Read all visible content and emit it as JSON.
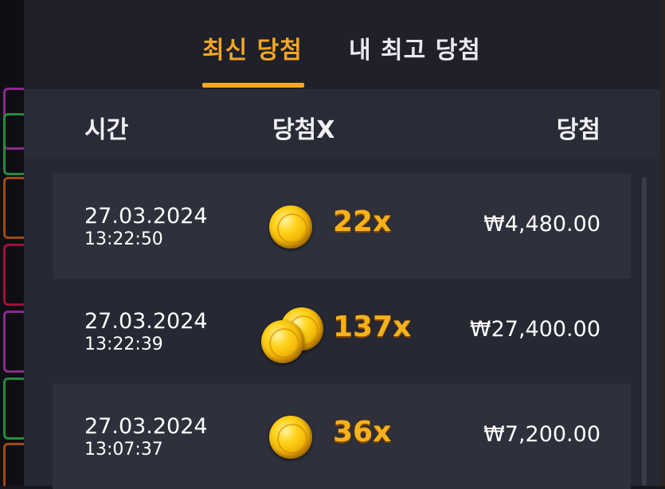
{
  "tabs": [
    {
      "label": "최신 당첨",
      "active": true
    },
    {
      "label": "내 최고 당첨",
      "active": false
    }
  ],
  "columns": {
    "time": "시간",
    "multiplier": "당첨X",
    "win": "당첨"
  },
  "rows": [
    {
      "date": "27.03.2024",
      "time": "13:22:50",
      "multiplier": "22x",
      "win": "₩4,480.00",
      "coin_count": 1
    },
    {
      "date": "27.03.2024",
      "time": "13:22:39",
      "multiplier": "137x",
      "win": "₩27,400.00",
      "coin_count": 2
    },
    {
      "date": "27.03.2024",
      "time": "13:07:37",
      "multiplier": "36x",
      "win": "₩7,200.00",
      "coin_count": 1
    }
  ],
  "colors": {
    "accent": "#f5a623",
    "panel": "#262833",
    "row_shaded": "#2e303c"
  },
  "icons": {
    "coin": "gold-coin-icon",
    "coins_stack": "gold-coins-icon"
  }
}
